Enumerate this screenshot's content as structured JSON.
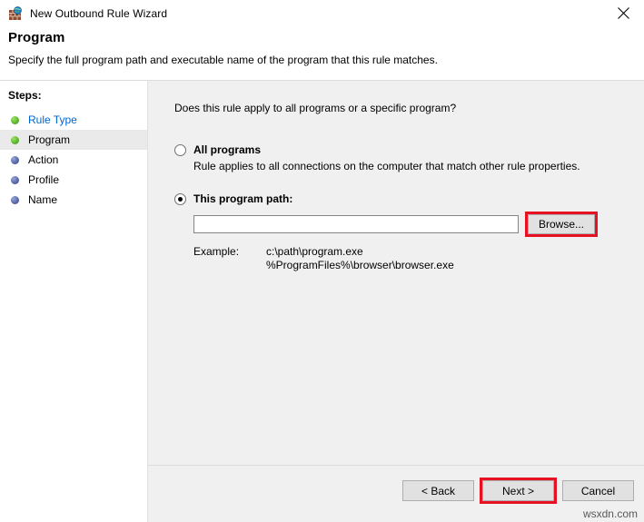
{
  "window": {
    "title": "New Outbound Rule Wizard",
    "icon": "firewall-globe-icon",
    "close_label": "✕"
  },
  "header": {
    "title": "Program",
    "subtitle": "Specify the full program path and executable name of the program that this rule matches."
  },
  "sidebar": {
    "label": "Steps:",
    "items": [
      {
        "label": "Rule Type",
        "state": "link",
        "bullet": "green"
      },
      {
        "label": "Program",
        "state": "current",
        "bullet": "green"
      },
      {
        "label": "Action",
        "state": "upcoming",
        "bullet": "blue"
      },
      {
        "label": "Profile",
        "state": "upcoming",
        "bullet": "blue"
      },
      {
        "label": "Name",
        "state": "upcoming",
        "bullet": "blue"
      }
    ]
  },
  "main": {
    "question": "Does this rule apply to all programs or a specific program?",
    "all_programs": {
      "label": "All programs",
      "description": "Rule applies to all connections on the computer that match other rule properties.",
      "selected": false
    },
    "this_program": {
      "label": "This program path:",
      "selected": true,
      "input_value": "",
      "input_placeholder": "",
      "browse_label": "Browse..."
    },
    "example": {
      "label": "Example:",
      "line1": "c:\\path\\program.exe",
      "line2": "%ProgramFiles%\\browser\\browser.exe"
    }
  },
  "footer": {
    "back_label": "< Back",
    "next_label": "Next >",
    "cancel_label": "Cancel"
  },
  "watermark": "wsxdn.com",
  "colors": {
    "highlight_red": "#e81123",
    "link_blue": "#0066cc",
    "panel_gray": "#f0f0f0",
    "step_current_bg": "#eaeaea"
  }
}
